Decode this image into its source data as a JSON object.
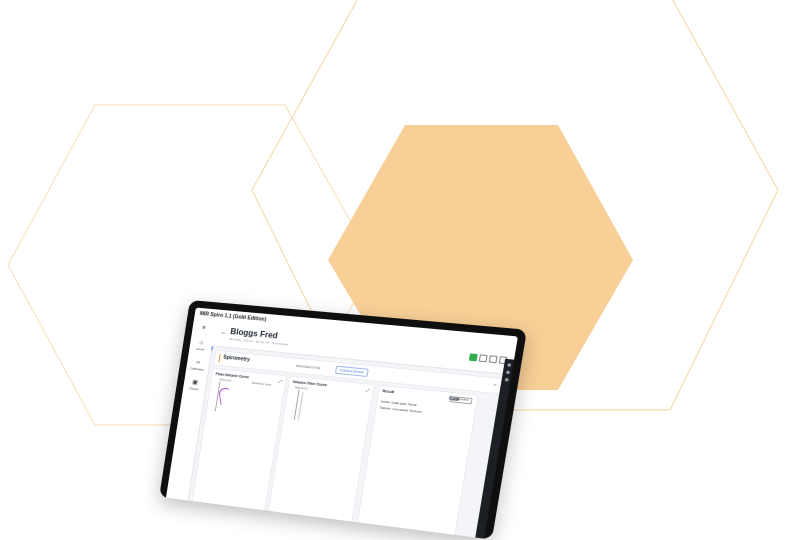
{
  "app": {
    "title": "MIR Spiro 1.1 (Gold Edition)"
  },
  "nav": {
    "menu_icon": "hamburger-icon",
    "items": [
      {
        "label": "Home",
        "icon": "home-icon",
        "active": true
      },
      {
        "label": "Calibration",
        "icon": "code-brackets-icon",
        "active": false
      },
      {
        "label": "Device",
        "icon": "device-icon",
        "active": false
      }
    ]
  },
  "patient": {
    "name": "Bloggs Fred",
    "meta": "58 years · 160 cm · 82 kg · M · Non smoker"
  },
  "section": {
    "title": "Spirometry",
    "date": "06/01/2022 07:51",
    "chip": "CONSULTATION"
  },
  "cards": {
    "flow_volume": {
      "title": "Flow-Volume Curve",
      "axis_hint": "Flow (L/s)",
      "note": "Reference curve"
    },
    "volume_time": {
      "title": "Volume-Time Curve",
      "axis_hint": "Volume (L)"
    },
    "results": {
      "title": "Result",
      "pill": "FVC",
      "pill2": "Interpretation",
      "rows": [
        {
          "label": "Variable",
          "value": "Quality grade",
          "extra": "Normal"
        },
        {
          "label": "Diagnosis",
          "value": "Lung capacity",
          "extra": "Restriction"
        }
      ]
    }
  },
  "colors": {
    "accent_orange": "#f08a2c",
    "hexagon_fill": "#f8cf96",
    "hexagon_outline": "#f6deb5",
    "trace_purple": "#b44ad4",
    "accent_blue": "#2e6fd8",
    "status_green": "#2fae4a"
  }
}
